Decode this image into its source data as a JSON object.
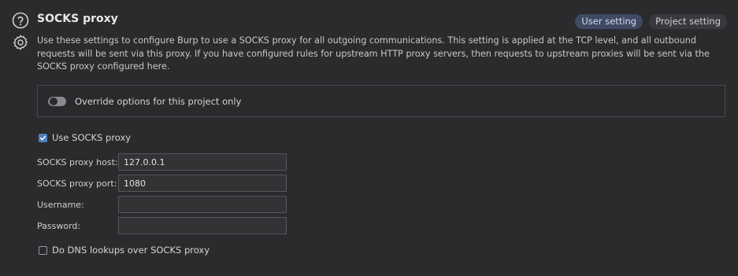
{
  "section": {
    "title": "SOCKS proxy",
    "description": "Use these settings to configure Burp to use a SOCKS proxy for all outgoing communications. This setting is applied at the TCP level, and all outbound requests will be sent via this proxy. If you have configured rules for upstream HTTP proxy servers, then requests to upstream proxies will be sent via the SOCKS proxy configured here.",
    "scope_pills": [
      {
        "label": "User setting",
        "active": true
      },
      {
        "label": "Project setting",
        "active": false
      }
    ]
  },
  "icons": {
    "help": "help-circle-icon",
    "settings": "gear-icon"
  },
  "override": {
    "label": "Override options for this project only",
    "enabled": false
  },
  "use_socks": {
    "label": "Use SOCKS proxy",
    "checked": true
  },
  "fields": {
    "host": {
      "label": "SOCKS proxy host:",
      "value": "127.0.0.1"
    },
    "port": {
      "label": "SOCKS proxy port:",
      "value": "1080"
    },
    "username": {
      "label": "Username:",
      "value": ""
    },
    "password": {
      "label": "Password:",
      "value": ""
    }
  },
  "dns_lookups": {
    "label": "Do DNS lookups over SOCKS proxy",
    "checked": false
  },
  "colors": {
    "background": "#2b2b2e",
    "accent": "#4f7ec2",
    "active_pill": "#3e4a63"
  }
}
